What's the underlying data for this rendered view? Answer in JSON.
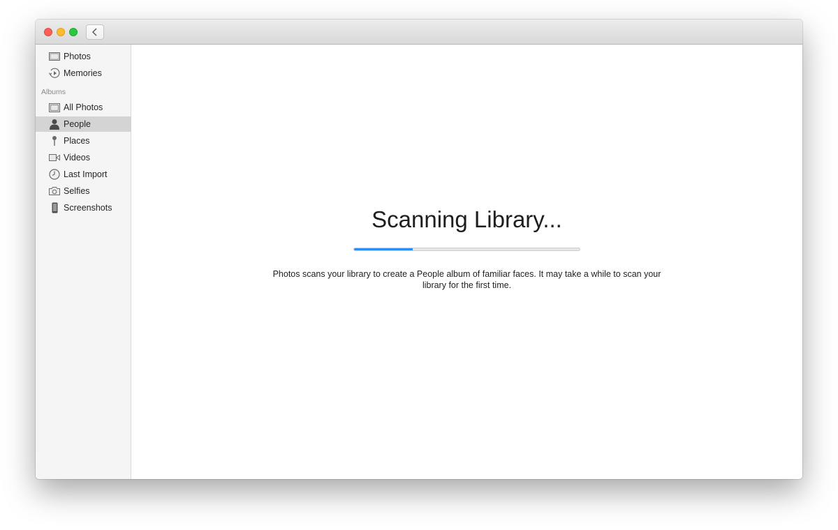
{
  "sidebar": {
    "library_items": [
      {
        "label": "Photos",
        "icon": "photos-icon"
      },
      {
        "label": "Memories",
        "icon": "memories-icon"
      }
    ],
    "albums_header": "Albums",
    "album_items": [
      {
        "label": "All Photos",
        "icon": "all-photos-icon"
      },
      {
        "label": "People",
        "icon": "person-icon",
        "selected": true
      },
      {
        "label": "Places",
        "icon": "pin-icon"
      },
      {
        "label": "Videos",
        "icon": "video-camera-icon"
      },
      {
        "label": "Last Import",
        "icon": "clock-icon"
      },
      {
        "label": "Selfies",
        "icon": "camera-icon"
      },
      {
        "label": "Screenshots",
        "icon": "phone-icon"
      }
    ]
  },
  "main": {
    "title": "Scanning Library...",
    "progress_fraction": 0.26,
    "description": "Photos scans your library to create a People album of familiar faces. It may take a while to scan your library for the first time."
  },
  "colors": {
    "accent": "#2f8cf0",
    "selection": "#d4d4d4",
    "sidebar_bg": "#f5f5f5"
  }
}
